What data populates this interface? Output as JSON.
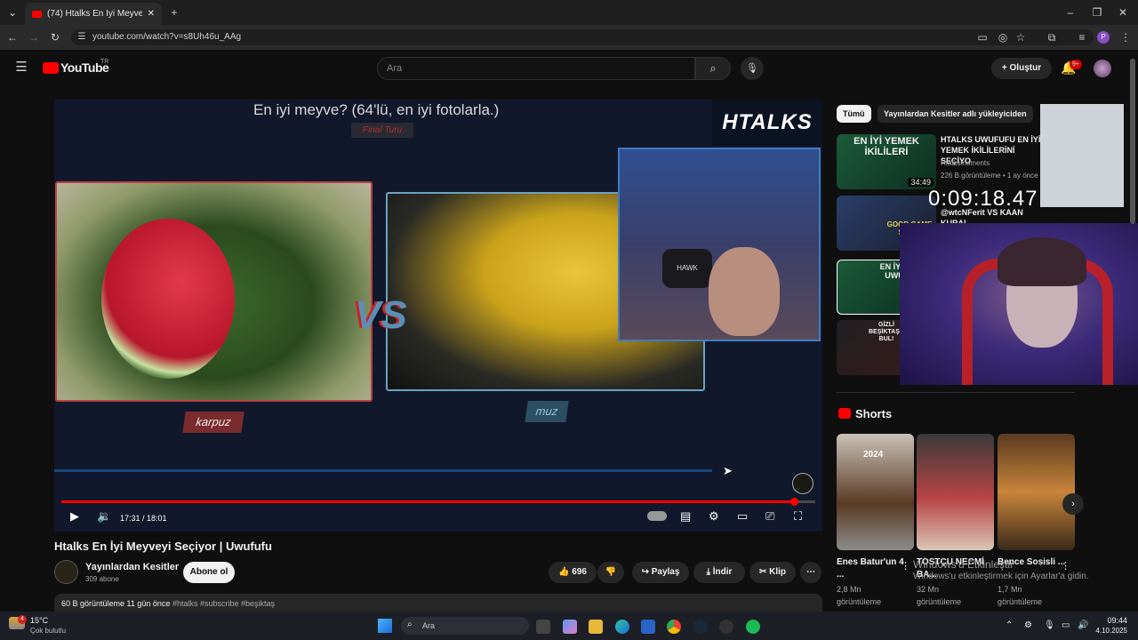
{
  "browser": {
    "tab_title": "(74) Htalks En İyi Meyveyi Seçiyo",
    "url": "youtube.com/watch?v=s8Uh46u_AAg",
    "profile_letter": "P"
  },
  "youtube": {
    "logo": "YouTube",
    "region": "TR",
    "search_placeholder": "Ara",
    "create_label": "Oluştur",
    "notif_count": "9+"
  },
  "video": {
    "frame_title": "En iyi meyve? (64'lü, en iyi fotolarla.)",
    "final_label": "Final Turu",
    "brand": "HTALKS",
    "vs": "VS",
    "left_label": "karpuz",
    "right_label": "muz",
    "hawk": "HAWK",
    "time": "17:31 / 18:01",
    "progress_fraction": 0.972
  },
  "meta": {
    "title": "Htalks En İyi Meyveyi Seçiyor | Uwufufu",
    "channel": "Yayınlardan Kesitler",
    "subscribers": "309 abone",
    "subscribe": "Abone ol",
    "likes": "696",
    "share": "Paylaş",
    "download": "İndir",
    "clip": "Klip",
    "views_time": "60 B görüntüleme  11 gün önce",
    "tags": "#htalks #subscribe #beşiktaş"
  },
  "sidebar": {
    "chip_all": "Tümü",
    "chip_channel": "Yayınlardan Kesitler adlı yükleyiciden",
    "rec1": {
      "thumb": "EN İYİ YEMEK İKİLİLERİ",
      "title": "HTALKS UWUFUFU EN İYİ YEMEK İKİLİLERİNİ SEÇİYO",
      "channel": "Htalksmoments",
      "meta": "226 B görüntüleme • 1 ay önce",
      "duration": "34:49"
    },
    "rec2": {
      "title": "@wtcNFerit VS KAAN KURAL, ...",
      "thumb": "GOOD GAME SHOW"
    },
    "rec3": {
      "thumb": "EN İYİ TAT UWUFU"
    },
    "rec4": {
      "thumb": "GİZLİ BEŞİKTAŞLI BUL!"
    },
    "timer": "0:09:18.47",
    "shorts_label": "Shorts",
    "shorts": [
      {
        "title": "Enes Batur'un 4 ...",
        "views": "2,8 Mn",
        "unit": "görüntüleme",
        "badge": "2024"
      },
      {
        "title": "TOSTÇU NECMİ BA...",
        "views": "32 Mn",
        "unit": "görüntüleme"
      },
      {
        "title": "Bence Sosisli ...",
        "views": "1,7 Mn",
        "unit": "görüntüleme"
      }
    ]
  },
  "windows_watermark": {
    "line1": "Windows'u Etkinleştir",
    "line2": "Windows'u etkinleştirmek için Ayarlar'a gidin."
  },
  "taskbar": {
    "temp": "15°C",
    "weather": "Çok bulutlu",
    "weather_badge": "4",
    "search": "Ara",
    "time": "09:44",
    "date": "4.10.2025"
  }
}
